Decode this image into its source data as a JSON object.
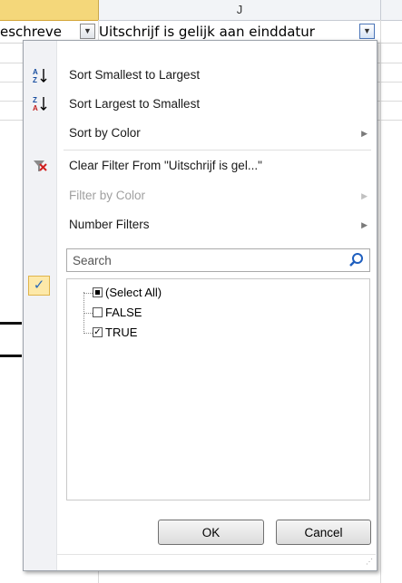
{
  "sheet": {
    "column_header": "J",
    "cell_left": "eschreve",
    "cell_right": "Uitschrijf is gelijk aan einddatur"
  },
  "menu": {
    "items": [
      {
        "label": "Sort Smallest to Largest",
        "icon": "sort-ascending-icon",
        "enabled": true
      },
      {
        "label": "Sort Largest to Smallest",
        "icon": "sort-descending-icon",
        "enabled": true
      },
      {
        "label": "Sort by Color",
        "enabled": true,
        "submenu": true
      },
      {
        "label": "Clear Filter From \"Uitschrijf is gel...\"",
        "icon": "clear-filter-icon",
        "enabled": true
      },
      {
        "label": "Filter by Color",
        "enabled": false,
        "submenu": true
      },
      {
        "label": "Number Filters",
        "enabled": true,
        "submenu": true
      }
    ],
    "search": {
      "placeholder": "Search"
    },
    "list": [
      {
        "label": "(Select All)",
        "state": "partial"
      },
      {
        "label": "FALSE",
        "state": "unchecked"
      },
      {
        "label": "TRUE",
        "state": "checked"
      }
    ],
    "ok_label": "OK",
    "cancel_label": "Cancel"
  },
  "colors": {
    "highlight": "#f4d77a",
    "check": "#2a6ab8",
    "gutter": "#f1f2f5"
  }
}
